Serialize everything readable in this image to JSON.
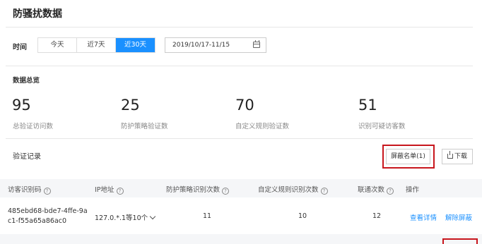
{
  "page": {
    "title": "防骚扰数据"
  },
  "filter": {
    "time_label": "时间",
    "ranges": [
      "今天",
      "近7天",
      "近30天"
    ],
    "active_range": "近30天",
    "date_range_value": "2019/10/17-11/15"
  },
  "overview": {
    "title": "数据总览",
    "stats": [
      {
        "value": "95",
        "label": "总验证访问数"
      },
      {
        "value": "25",
        "label": "防护策略验证数"
      },
      {
        "value": "70",
        "label": "自定义规则验证数"
      },
      {
        "value": "51",
        "label": "识别可疑访客数"
      }
    ]
  },
  "records": {
    "title": "验证记录",
    "blocklist_button": "屏蔽名单(1)",
    "download_button": "下载"
  },
  "table": {
    "columns": [
      "访客识别码",
      "IP地址",
      "防护策略识别次数",
      "自定义规则识别次数",
      "联通次数",
      "操作"
    ],
    "rows": [
      {
        "visitor_id": "485ebd68-bde7-4ffe-9ac1-f55a65a86ac0",
        "ip": "127.0.*.1等10个",
        "policy_count": "11",
        "rule_count": "10",
        "connect_count": "12",
        "action_detail": "查看详情",
        "action_unblock": "解除屏蔽"
      }
    ]
  },
  "colors": {
    "accent": "#1a90ff",
    "highlight": "#c8161d"
  }
}
